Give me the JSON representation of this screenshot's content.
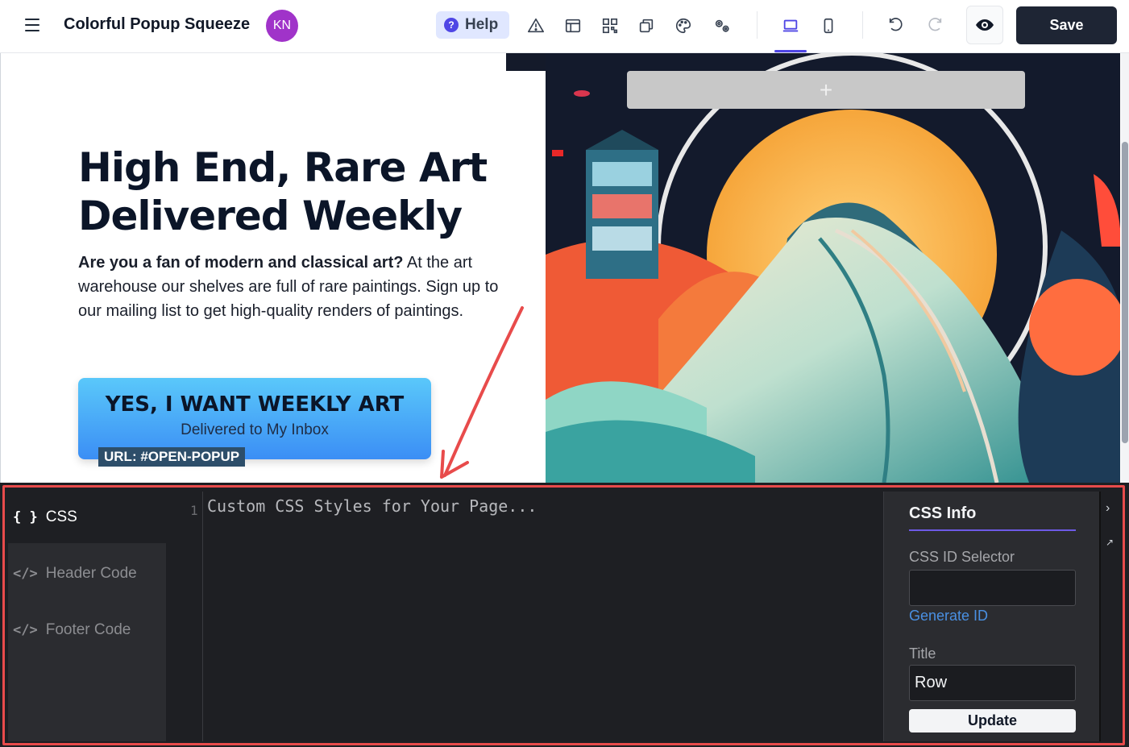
{
  "app": {
    "page_title": "Colorful Popup Squeeze",
    "avatar_initials": "KN",
    "avatar_color": "#a033c9",
    "help_label": "Help",
    "save_label": "Save",
    "toolbar_icons": [
      "warning-icon",
      "layout-icon",
      "qr-code-icon",
      "copy-icon",
      "palette-icon",
      "settings-icon"
    ],
    "device_modes": [
      "desktop",
      "mobile"
    ],
    "active_device": "desktop",
    "accent_color": "#4f46e5"
  },
  "canvas": {
    "hero_title_line1": "High End, Rare Art",
    "hero_title_line2": "Delivered Weekly",
    "hero_bold": "Are you a fan of modern and classical art?",
    "hero_rest": " At the art warehouse our shelves are full of rare paintings. Sign up to our mailing list to get high-quality renders of paintings.",
    "cta_main": "YES, I WANT WEEKLY ART",
    "cta_sub": "Delivered to My Inbox",
    "url_tag": "URL: #OPEN-POPUP",
    "add_row_symbol": "+"
  },
  "code_panel": {
    "tabs": [
      {
        "icon": "{ }",
        "label": "CSS",
        "active": true
      },
      {
        "icon": "</>",
        "label": "Header Code",
        "active": false
      },
      {
        "icon": "</>",
        "label": "Footer Code",
        "active": false
      }
    ],
    "line_number": "1",
    "placeholder": "Custom CSS Styles for Your Page...",
    "info_title": "CSS Info",
    "css_id_label": "CSS ID Selector",
    "css_id_value": "",
    "generate_id_label": "Generate ID",
    "title_label": "Title",
    "title_value": "Row",
    "update_label": "Update",
    "highlight_color": "#e84b4b"
  }
}
